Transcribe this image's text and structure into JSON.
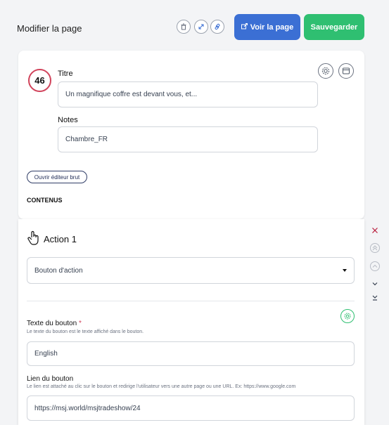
{
  "header": {
    "title": "Modifier la page",
    "view_button": "Voir la page",
    "save_button": "Sauvegarder",
    "icons": [
      "trash-icon",
      "expand-icon",
      "link-icon"
    ]
  },
  "page": {
    "number": "46",
    "title_label": "Titre",
    "title_value": "Un magnifique coffre est devant vous, et...",
    "notes_label": "Notes",
    "notes_value": "Chambre_FR",
    "raw_editor_button": "Ouvrir éditeur brut",
    "contents_heading": "CONTENUS"
  },
  "action": {
    "title": "Action 1",
    "type_selected": "Bouton d'action",
    "button_text_label": "Texte du bouton",
    "required_mark": "*",
    "button_text_help": "Le texte du bouton est le texte affiché dans le bouton.",
    "button_text_value": "English",
    "button_link_label": "Lien du bouton",
    "button_link_help": "Le lien est attaché au clic sur le bouton et redirige l'utilisateur vers une autre page ou une URL. Ex: https://www.google.com",
    "button_link_value": "https://msj.world/msjtradeshow/24"
  },
  "colors": {
    "primary": "#3b6fd4",
    "success": "#2fbf71",
    "danger": "#d1435b"
  }
}
